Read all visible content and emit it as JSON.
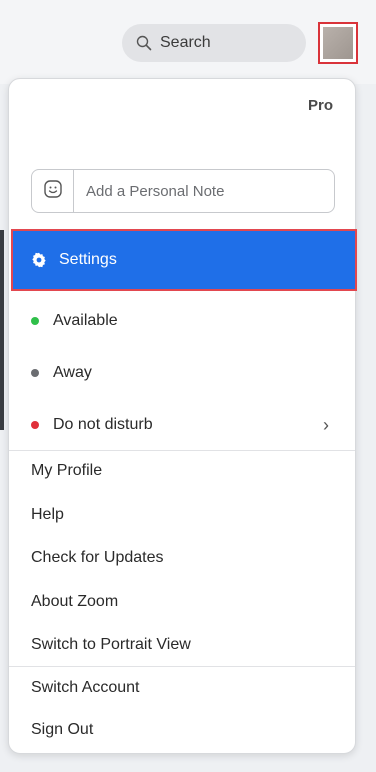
{
  "search": {
    "label": "Search"
  },
  "plan": {
    "label": "Pro"
  },
  "note": {
    "placeholder": "Add a Personal Note"
  },
  "settings": {
    "label": "Settings"
  },
  "status": [
    {
      "label": "Available",
      "color": "#2fbf4a"
    },
    {
      "label": "Away",
      "color": "#6b6d71"
    },
    {
      "label": "Do not disturb",
      "color": "#e0303a"
    }
  ],
  "dnd_chevron": "›",
  "menu_group1": [
    {
      "label": "My Profile"
    },
    {
      "label": "Help"
    },
    {
      "label": "Check for Updates"
    },
    {
      "label": "About Zoom"
    },
    {
      "label": "Switch to Portrait View"
    }
  ],
  "menu_group2": [
    {
      "label": "Switch Account"
    },
    {
      "label": "Sign Out"
    }
  ],
  "colors": {
    "accent": "#1f6fe8",
    "highlight_border": "#e2474f"
  }
}
